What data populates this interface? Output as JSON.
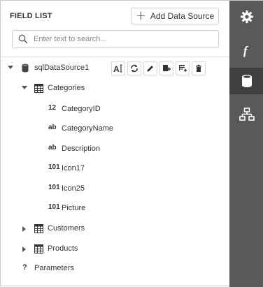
{
  "header": {
    "title": "FIELD LIST",
    "add_button_label": "Add Data Source"
  },
  "search": {
    "placeholder": "Enter text to search..."
  },
  "tree": {
    "datasource": "sqlDataSource1",
    "categories": {
      "label": "Categories",
      "fields": [
        {
          "type": "12",
          "name": "CategoryID"
        },
        {
          "type": "ab",
          "name": "CategoryName"
        },
        {
          "type": "ab",
          "name": "Description"
        },
        {
          "type": "101",
          "name": "Icon17"
        },
        {
          "type": "101",
          "name": "Icon25"
        },
        {
          "type": "101",
          "name": "Picture"
        }
      ]
    },
    "customers": "Customers",
    "products": "Products",
    "parameters": {
      "icon": "?",
      "label": "Parameters"
    }
  },
  "toolbar": {
    "items": [
      "rename-icon",
      "refresh-icon",
      "edit-icon",
      "add-query-icon",
      "add-calculated-field-icon",
      "delete-icon"
    ]
  },
  "sidebar": {
    "tabs": [
      "settings-gear-icon",
      "expressions-function-icon",
      "field-list-database-icon",
      "report-explorer-hierarchy-icon"
    ],
    "active_index": 2
  },
  "colors": {
    "sidebar_bg": "#595959",
    "sidebar_active": "#3f3f3f"
  }
}
